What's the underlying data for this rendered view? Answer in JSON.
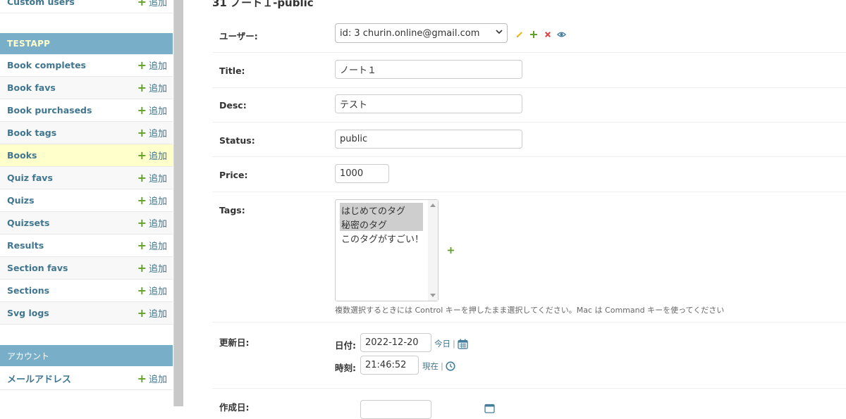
{
  "page_title": "31 ノート１-public",
  "sidebar": {
    "top_item": {
      "label": "Custom users",
      "add_label": "追加"
    },
    "app_caption": "TESTAPP",
    "items": [
      {
        "label": "Book completes",
        "add_label": "追加"
      },
      {
        "label": "Book favs",
        "add_label": "追加"
      },
      {
        "label": "Book purchaseds",
        "add_label": "追加"
      },
      {
        "label": "Book tags",
        "add_label": "追加"
      },
      {
        "label": "Books",
        "add_label": "追加",
        "current": true
      },
      {
        "label": "Quiz favs",
        "add_label": "追加"
      },
      {
        "label": "Quizs",
        "add_label": "追加"
      },
      {
        "label": "Quizsets",
        "add_label": "追加"
      },
      {
        "label": "Results",
        "add_label": "追加"
      },
      {
        "label": "Section favs",
        "add_label": "追加"
      },
      {
        "label": "Sections",
        "add_label": "追加"
      },
      {
        "label": "Svg logs",
        "add_label": "追加"
      }
    ],
    "account_caption": "アカウント",
    "account_items": [
      {
        "label": "メールアドレス",
        "add_label": "追加"
      }
    ]
  },
  "form": {
    "user": {
      "label": "ユーザー:",
      "selected": "id: 3 churin.online@gmail.com"
    },
    "title": {
      "label": "Title:",
      "value": "ノート１"
    },
    "desc": {
      "label": "Desc:",
      "value": "テスト"
    },
    "status": {
      "label": "Status:",
      "value": "public"
    },
    "price": {
      "label": "Price:",
      "value": "1000"
    },
    "tags": {
      "label": "Tags:",
      "options": [
        {
          "text": "はじめてのタグ",
          "selected": true
        },
        {
          "text": "秘密のタグ",
          "selected": true
        },
        {
          "text": "このタグがすごい！",
          "selected": false
        }
      ],
      "help": "複数選択するときには Control キーを押したまま選択してください。Mac は Command キーを使ってください"
    },
    "updated": {
      "label": "更新日:",
      "date_label": "日付:",
      "date_value": "2022-12-20",
      "today_label": "今日",
      "time_label": "時刻:",
      "time_value": "21:46:52",
      "now_label": "現在"
    },
    "created": {
      "label": "作成日:"
    }
  },
  "colors": {
    "link": "#417690",
    "caption_bg": "#79aec8",
    "current_row": "#ffffcc",
    "add_green": "#5fa225"
  }
}
